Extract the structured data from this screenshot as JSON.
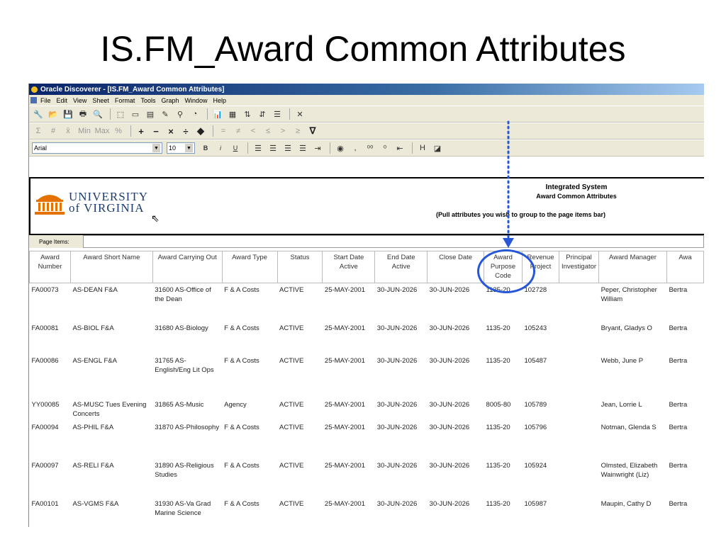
{
  "slide": {
    "title": "IS.FM_Award Common Attributes"
  },
  "app": {
    "window_title": "Oracle Discoverer - [IS.FM_Award Common Attributes]",
    "menu": [
      "File",
      "Edit",
      "View",
      "Sheet",
      "Format",
      "Tools",
      "Graph",
      "Window",
      "Help"
    ],
    "font_select": "Arial",
    "size_select": "10"
  },
  "report": {
    "title_line1": "Integrated System",
    "title_line2": "Award Common Attributes",
    "subtitle": "(Pull attributes you wish to group to the page items bar)",
    "logo_line1": "UNIVERSITY",
    "logo_line2": "of VIRGINIA"
  },
  "page_items_label": "Page Items:",
  "table": {
    "headers": [
      "Award Number",
      "Award Short Name",
      "Award Carrying Out",
      "Award Type",
      "Status",
      "Start Date Active",
      "End Date Active",
      "Close Date",
      "Award Purpose Code",
      "Revenue Project",
      "Principal Investigator",
      "Award Manager",
      "Awa"
    ],
    "rows": [
      [
        "FA00073",
        "AS-DEAN F&A",
        "31600 AS-Office of the Dean",
        "F & A Costs",
        "ACTIVE",
        "25-MAY-2001",
        "30-JUN-2026",
        "30-JUN-2026",
        "1135-20",
        "102728",
        "",
        "Peper, Christopher William",
        "Bertra"
      ],
      [
        "FA00081",
        "AS-BIOL F&A",
        "31680 AS-Biology",
        "F & A Costs",
        "ACTIVE",
        "25-MAY-2001",
        "30-JUN-2026",
        "30-JUN-2026",
        "1135-20",
        "105243",
        "",
        "Bryant, Gladys O",
        "Bertra"
      ],
      [
        "FA00086",
        "AS-ENGL F&A",
        "31765 AS-English/Eng Lit Ops",
        "F & A Costs",
        "ACTIVE",
        "25-MAY-2001",
        "30-JUN-2026",
        "30-JUN-2026",
        "1135-20",
        "105487",
        "",
        "Webb, June P",
        "Bertra"
      ],
      [
        "YY00085",
        "AS-MUSC Tues Evening Concerts",
        "31865 AS-Music",
        "Agency",
        "ACTIVE",
        "25-MAY-2001",
        "30-JUN-2026",
        "30-JUN-2026",
        "8005-80",
        "105789",
        "",
        "Jean, Lorrie L",
        "Bertra"
      ],
      [
        "FA00094",
        "AS-PHIL F&A",
        "31870 AS-Philosophy",
        "F & A Costs",
        "ACTIVE",
        "25-MAY-2001",
        "30-JUN-2026",
        "30-JUN-2026",
        "1135-20",
        "105796",
        "",
        "Notman, Glenda S",
        "Bertra"
      ],
      [
        "FA00097",
        "AS-RELI F&A",
        "31890 AS-Religious Studies",
        "F & A Costs",
        "ACTIVE",
        "25-MAY-2001",
        "30-JUN-2026",
        "30-JUN-2026",
        "1135-20",
        "105924",
        "",
        "Olmsted, Elizabeth Wainwright (Liz)",
        "Bertra"
      ],
      [
        "FA00101",
        "AS-VGMS F&A",
        "31930 AS-Va Grad Marine Science",
        "F & A Costs",
        "ACTIVE",
        "25-MAY-2001",
        "30-JUN-2026",
        "30-JUN-2026",
        "1135-20",
        "105987",
        "",
        "Maupin, Cathy D",
        "Bertra"
      ]
    ],
    "row_heights": [
      54,
      46,
      62,
      18,
      54,
      54,
      30
    ]
  },
  "accent_colors": {
    "annotation": "#2557d6",
    "uva_blue": "#1d3b6e",
    "uva_orange": "#e57200"
  }
}
